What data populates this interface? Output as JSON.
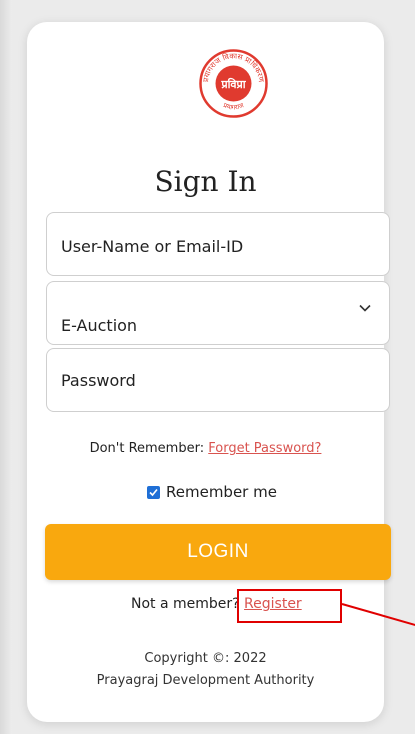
{
  "logo": {
    "top_text": "प्रयागराज विकास प्राधिकरण",
    "center_text": "प्रविप्रा",
    "bottom_text": "प्रयागराज"
  },
  "title": "Sign In",
  "fields": {
    "username_placeholder": "User-Name or Email-ID",
    "auction_type_value": "E-Auction",
    "password_placeholder": "Password"
  },
  "forget": {
    "prefix": "Don't Remember:",
    "link": "Forget Password?"
  },
  "remember": {
    "label": "Remember me",
    "checked": true
  },
  "login_label": "LOGIN",
  "member": {
    "prefix": "Not a member?",
    "link": "Register"
  },
  "copyright": {
    "line1": "Copyright ©: 2022",
    "line2": "Prayagraj Development Authority"
  },
  "colors": {
    "accent": "#f9a80e",
    "link": "#d9534f",
    "checkbox": "#1f6fd6",
    "highlight": "#e00000"
  }
}
